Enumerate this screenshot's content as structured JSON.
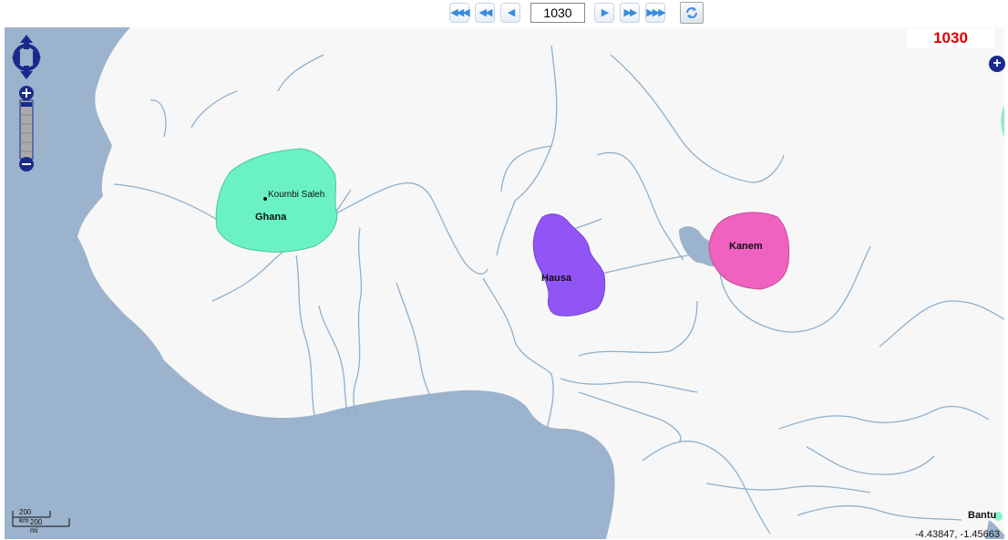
{
  "toolbar": {
    "buttons": [
      {
        "name": "first-button",
        "glyph": "◀◀◀"
      },
      {
        "name": "fast-back-button",
        "glyph": "◀◀"
      },
      {
        "name": "back-button",
        "glyph": "◀"
      },
      {
        "name": "forward-button",
        "glyph": "▶"
      },
      {
        "name": "fast-forward-button",
        "glyph": "▶▶"
      },
      {
        "name": "last-button",
        "glyph": "▶▶▶"
      }
    ],
    "year_value": "1030",
    "refresh_icon": "refresh-icon"
  },
  "map": {
    "year_display": "1030",
    "colors": {
      "water": "#9bb3cc",
      "land": "#f7f7f7",
      "river": "#8fb0cc",
      "ghana": "#6af2c4",
      "hausa": "#9155f5",
      "kanem": "#f062c0"
    },
    "regions": [
      {
        "key": "ghana",
        "label": "Ghana",
        "color": "#6af2c4"
      },
      {
        "key": "hausa",
        "label": "Hausa",
        "color": "#9155f5"
      },
      {
        "key": "kanem",
        "label": "Kanem",
        "color": "#f062c0"
      }
    ],
    "cities": [
      {
        "name": "Koumbi Saleh"
      }
    ],
    "edge_label": "Bantu",
    "scale": {
      "km": "200 km",
      "mi": "200 mi"
    },
    "coordinates": "-4.43847, -1.45663"
  },
  "controls": {
    "pan_icon": "pan-arrows-icon",
    "zoom_in_glyph": "+",
    "zoom_out_glyph": "−",
    "layer_switcher_glyph": "+"
  }
}
